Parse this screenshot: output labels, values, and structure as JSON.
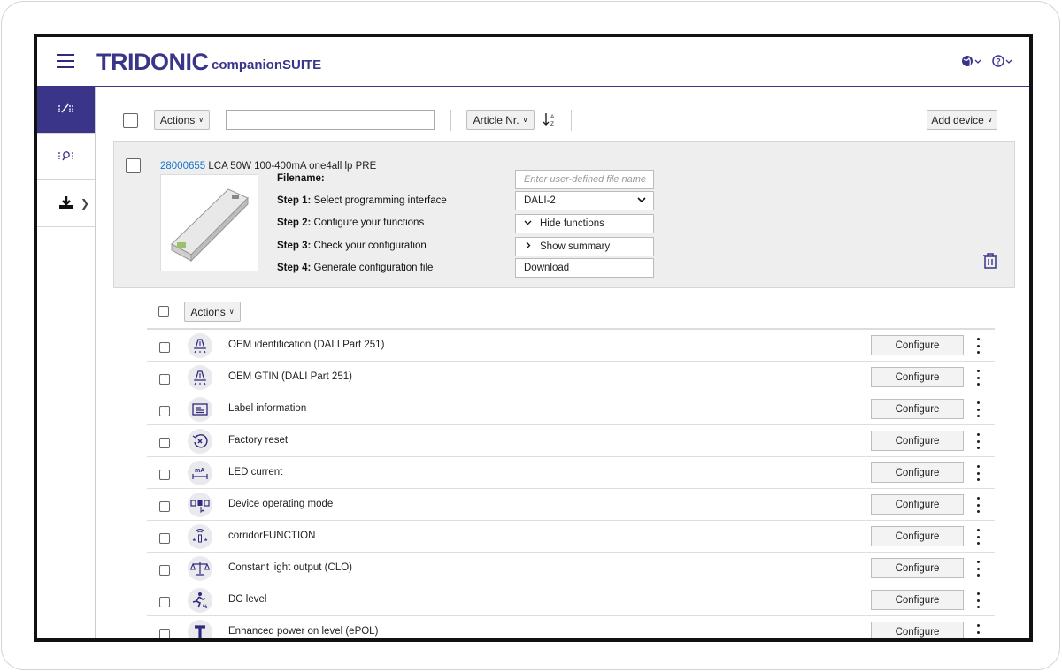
{
  "header": {
    "logo": "TRIDONIC",
    "logo_sub": "companionSUITE",
    "globe_icon": "globe-icon",
    "help_icon": "help-icon"
  },
  "sidebar": {
    "items": [
      {
        "icon": "configure-icon"
      },
      {
        "icon": "search-device-icon"
      },
      {
        "icon": "download-icon"
      }
    ]
  },
  "toolbar": {
    "actions_label": "Actions",
    "search_value": "",
    "sort_label": "Article Nr.",
    "add_device_label": "Add device"
  },
  "device": {
    "article_nr": "28000655",
    "name": "LCA 50W 100-400mA one4all lp PRE",
    "filename_label": "Filename:",
    "filename_placeholder": "Enter user-defined file name",
    "steps": [
      {
        "num": "Step 1:",
        "text": "Select programming interface",
        "value": "DALI-2"
      },
      {
        "num": "Step 2:",
        "text": "Configure your functions",
        "value": "Hide functions"
      },
      {
        "num": "Step 3:",
        "text": "Check your configuration",
        "value": "Show summary"
      },
      {
        "num": "Step 4:",
        "text": "Generate configuration file",
        "value": "Download"
      }
    ]
  },
  "functions": {
    "actions_label": "Actions",
    "configure_label": "Configure",
    "items": [
      {
        "label": "OEM identification (DALI Part 251)",
        "icon": "lamp-icon"
      },
      {
        "label": "OEM GTIN (DALI Part 251)",
        "icon": "lamp-icon"
      },
      {
        "label": "Label information",
        "icon": "label-icon"
      },
      {
        "label": "Factory reset",
        "icon": "reset-icon"
      },
      {
        "label": "LED current",
        "icon": "current-icon"
      },
      {
        "label": "Device operating mode",
        "icon": "mode-icon"
      },
      {
        "label": "corridorFUNCTION",
        "icon": "corridor-icon"
      },
      {
        "label": "Constant light output (CLO)",
        "icon": "scale-icon"
      },
      {
        "label": "DC level",
        "icon": "dc-level-icon"
      },
      {
        "label": "Enhanced power on level (ePOL)",
        "icon": "epol-icon"
      }
    ]
  }
}
